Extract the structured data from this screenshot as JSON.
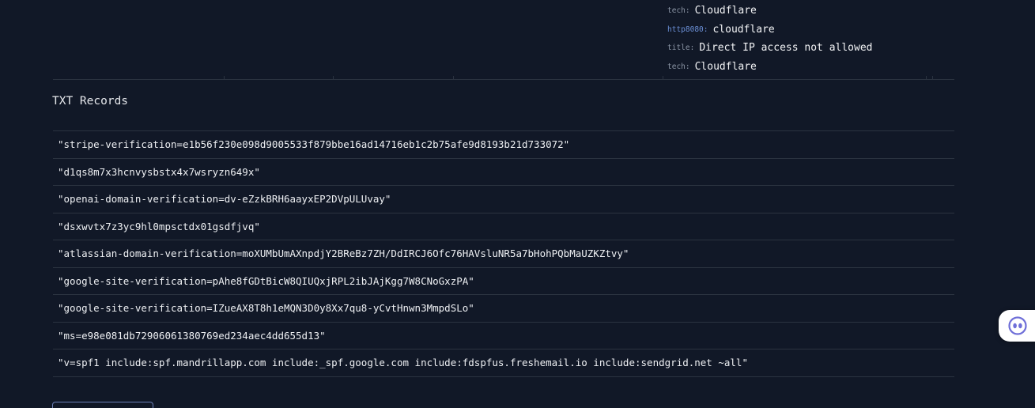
{
  "tech_list": [
    {
      "key": "tech:",
      "value": "Cloudflare",
      "key_color": "#8b95a5"
    },
    {
      "key": "http8080:",
      "value": "cloudflare",
      "key_color": "#6b8fd6"
    },
    {
      "key": "title:",
      "value": "Direct IP access not allowed",
      "key_color": "#8b95a5"
    },
    {
      "key": "tech:",
      "value": "Cloudflare",
      "key_color": "#8b95a5"
    }
  ],
  "txt_section": {
    "title": "TXT Records",
    "records": [
      "\"stripe-verification=e1b56f230e098d9005533f879bbe16ad14716eb1c2b75afe9d8193b21d733072\"",
      "\"d1qs8m7x3hcnvysbstx4x7wsryzn649x\"",
      "\"openai-domain-verification=dv-eZzkBRH6aayxEP2DVpULUvay\"",
      "\"dsxwvtx7z3yc9hl0mpsctdx01gsdfjvq\"",
      "\"atlassian-domain-verification=moXUMbUmAXnpdjY2BReBz7ZH/DdIRCJ6Ofc76HAVsluNR5a7bHohPQbMaUZKZtvy\"",
      "\"google-site-verification=pAhe8fGDtBicW8QIUQxjRPL2ibJAjKgg7W8CNoGxzPA\"",
      "\"google-site-verification=IZueAX8T8h1eMQN3D0y8Xx7qu8-yCvtHnwn3MmpdSLo\"",
      "\"ms=e98e081db72906061380769ed234aec4dd655d13\"",
      "\"v=spf1 include:spf.mandrillapp.com include:_spf.google.com include:fdspfus.freshemail.io include:sendgrid.net ~all\""
    ]
  },
  "assistant_widget": {
    "icon": "assistant-face-icon",
    "color": "#6f6fd8"
  },
  "colors": {
    "background": "#111827",
    "border": "#2b3340",
    "text": "#eef0f3",
    "button_border": "#6b7fb5"
  }
}
